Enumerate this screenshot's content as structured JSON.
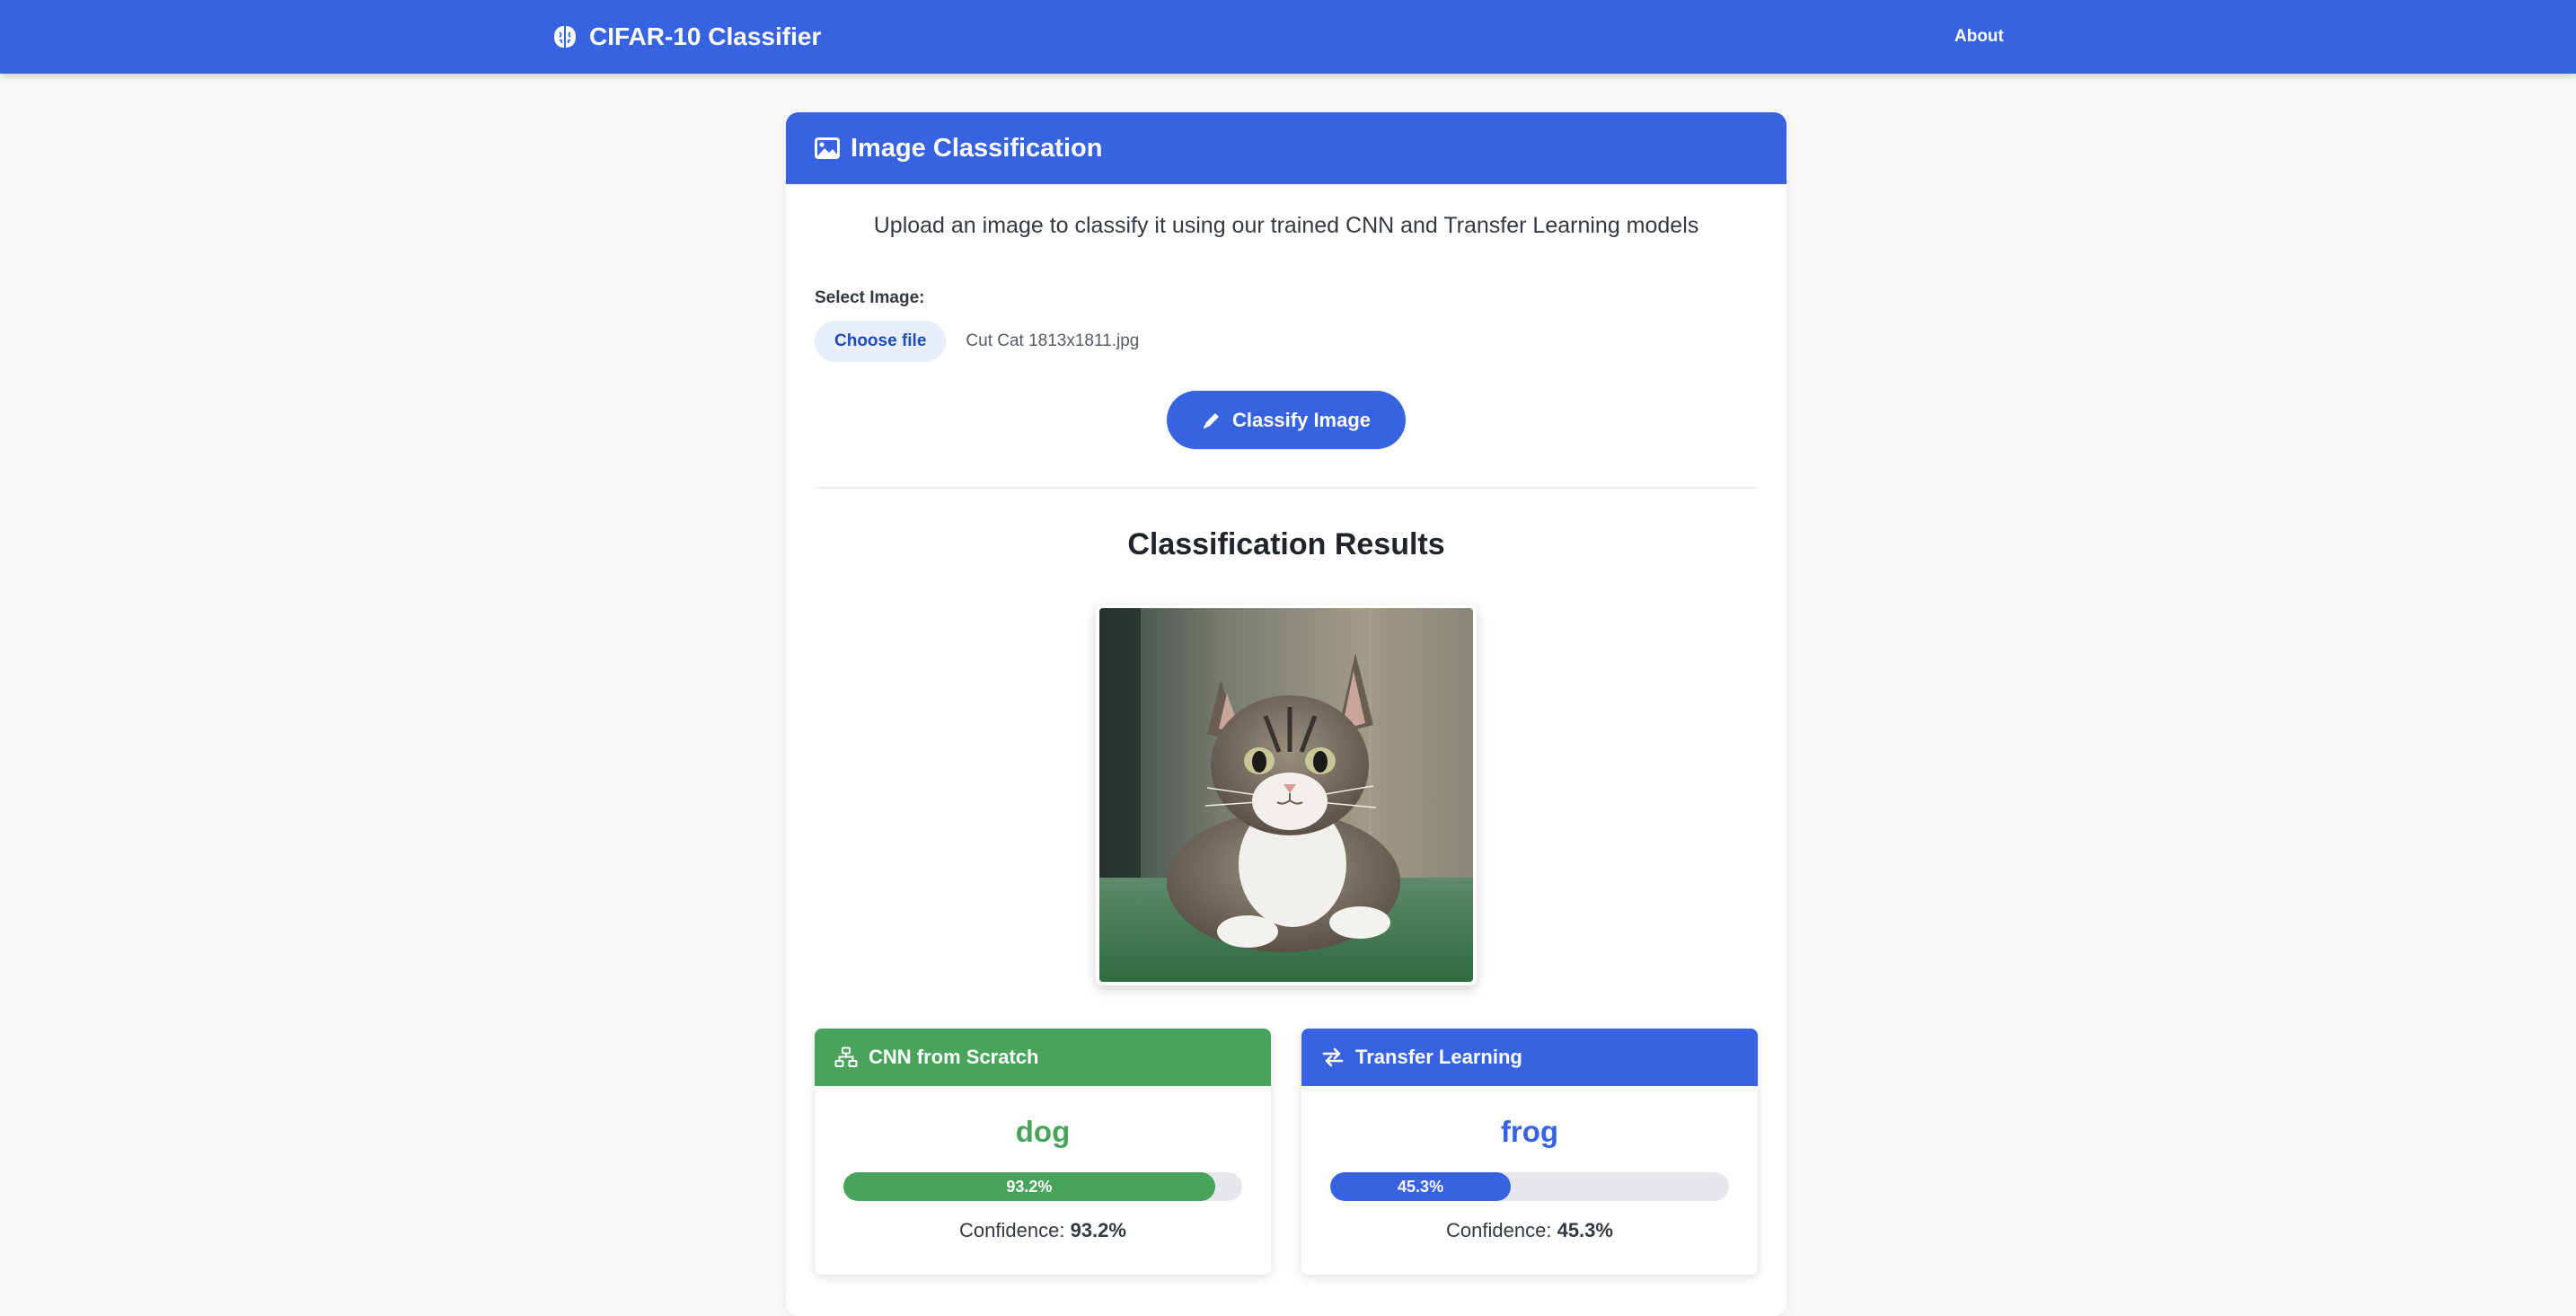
{
  "navbar": {
    "brand": "CIFAR-10 Classifier",
    "brand_icon": "brain-icon",
    "about_label": "About",
    "color": "#3763e0"
  },
  "main": {
    "title": "Image Classification",
    "title_icon": "image-icon",
    "intro": "Upload an image to classify it using our trained CNN and Transfer Learning models",
    "select_label": "Select Image:",
    "choose_file_label": "Choose file",
    "file_name": "Cut Cat 1813x1811.jpg",
    "classify_label": "Classify Image",
    "classify_icon": "pencil-icon"
  },
  "results": {
    "title": "Classification Results",
    "image_alt": "uploaded cat photo",
    "models": [
      {
        "name": "CNN from Scratch",
        "icon": "network-icon",
        "prediction": "dog",
        "confidence": 93.2,
        "confidence_text": "93.2%",
        "confidence_label": "Confidence:",
        "color": "#4aa35a"
      },
      {
        "name": "Transfer Learning",
        "icon": "exchange-icon",
        "prediction": "frog",
        "confidence": 45.3,
        "confidence_text": "45.3%",
        "confidence_label": "Confidence:",
        "color": "#3763e0"
      }
    ]
  }
}
